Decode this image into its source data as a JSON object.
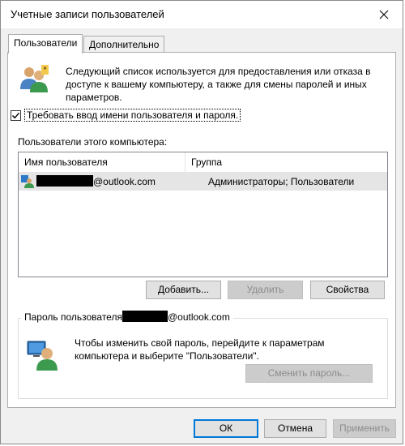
{
  "window": {
    "title": "Учетные записи пользователей"
  },
  "tabs": [
    {
      "label": "Пользователи",
      "active": true
    },
    {
      "label": "Дополнительно",
      "active": false
    }
  ],
  "intro": {
    "text": "Следующий список используется для предоставления или отказа в доступе к вашему компьютеру, а также для смены паролей и иных параметров."
  },
  "require_login": {
    "label": "Требовать ввод имени пользователя и пароля.",
    "checked": true
  },
  "users_section": {
    "label": "Пользователи этого компьютера:",
    "columns": {
      "name": "Имя пользователя",
      "group": "Группа"
    },
    "rows": [
      {
        "name_suffix": "@outlook.com",
        "group": "Администраторы; Пользователи"
      }
    ]
  },
  "actions": {
    "add": "Добавить...",
    "remove": "Удалить",
    "properties": "Свойства"
  },
  "password_group": {
    "title_prefix": "Пароль пользователя",
    "title_suffix": "@outlook.com",
    "text": "Чтобы изменить свой пароль, перейдите к параметрам компьютера и выберите \"Пользователи\".",
    "change_button": "Сменить пароль..."
  },
  "footer": {
    "ok": "ОК",
    "cancel": "Отмена",
    "apply": "Применить"
  },
  "colors": {
    "selection": "#e5e5e5",
    "focus": "#0078d7",
    "disabled_text": "#8c8c8c"
  }
}
